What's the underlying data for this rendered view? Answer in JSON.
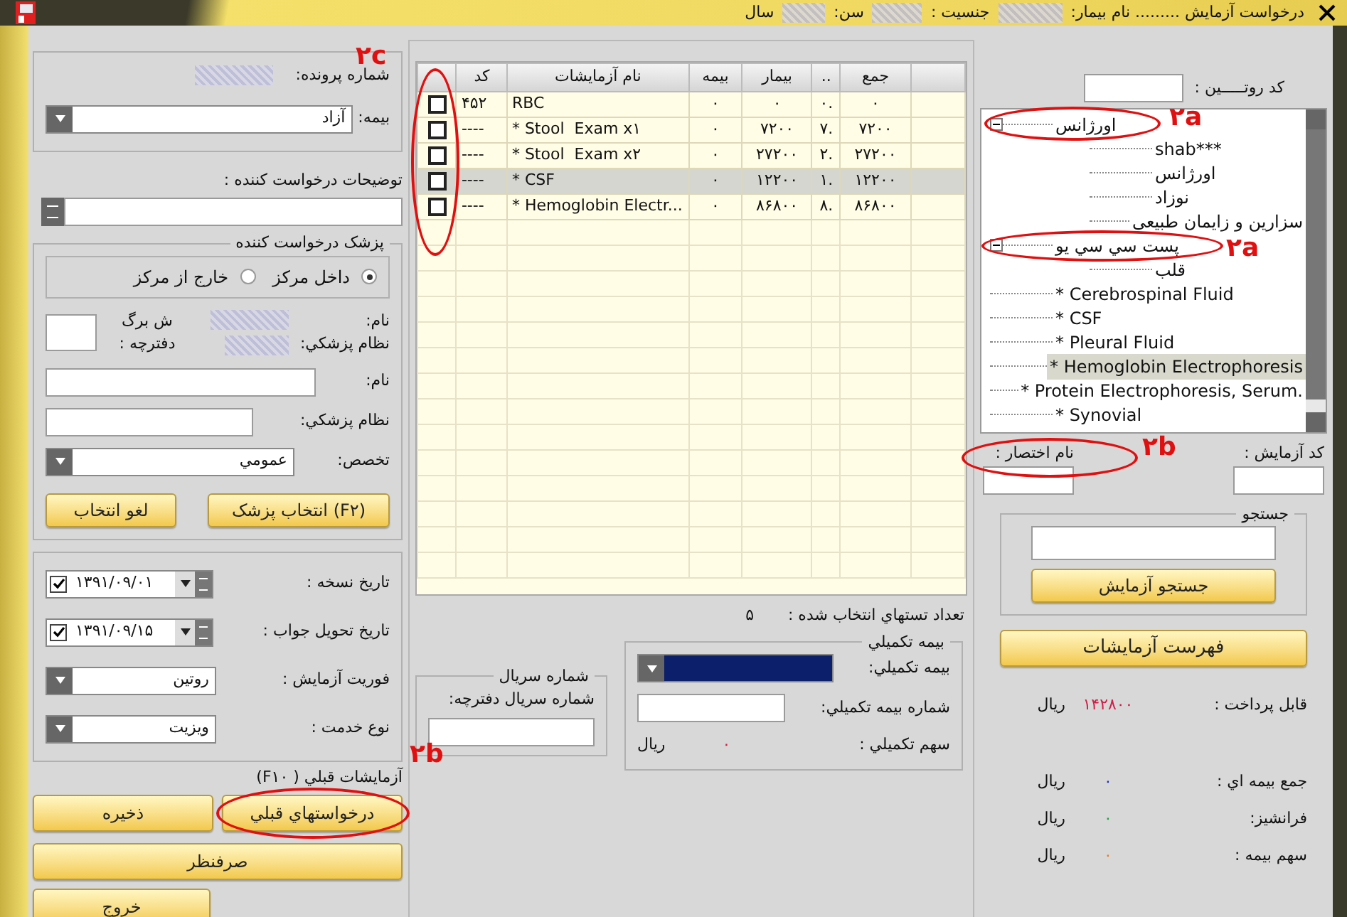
{
  "window": {
    "title": "درخواست آزمایش ......... نام بیمار:",
    "gender_label": "جنسیت :",
    "age_label": "سن:",
    "age_unit": "سال"
  },
  "left_panel": {
    "file_label": "شماره پرونده:",
    "insurance_label": "بیمه:",
    "insurance_value": "آزاد",
    "requester_notes_label": "توضیحات درخواست کننده :",
    "physician": {
      "legend": "پزشک درخواست کننده",
      "options": [
        {
          "label": "داخل مرکز",
          "selected": true
        },
        {
          "label": "خارج از مرکز",
          "selected": false
        }
      ],
      "name_label": "نام:",
      "code_label": "نظام پزشکي:",
      "sheet_label": "ش برگ دفترچه :",
      "name_field_label": "نام:",
      "code_field_label": "نظام پزشکي:",
      "specialty_label": "تخصص:",
      "specialty_value": "عمومي",
      "select_button": "(F۲) انتخاب پزشک",
      "cancel_button": "لغو انتخاب"
    },
    "dates": [
      {
        "label": "تاریخ نسخه :",
        "value": "۱۳۹۱/۰۹/۰۱",
        "checked": true
      },
      {
        "label": "تاریخ تحویل جواب :",
        "value": "۱۳۹۱/۰۹/۱۵",
        "checked": true
      }
    ],
    "combos": [
      {
        "label": "فوریت آزمایش :",
        "value": "روتین"
      },
      {
        "label": "نوع خدمت :",
        "value": "ویزیت"
      }
    ],
    "previous_label": "آزمایشات قبلي ( F۱۰)",
    "previous_button": "درخواستهاي قبلي",
    "save_button": "ذخیره",
    "cancel_button": "صرفنظر",
    "exit_button": "خروج"
  },
  "grid": {
    "columns": [
      "جمع",
      "..",
      "بیمار",
      "بیمه",
      "نام آزمایشات",
      "کد"
    ],
    "rows": [
      {
        "checked": false,
        "selected": false,
        "cells": [
          "۰",
          "۰.",
          "۰",
          "۰",
          "RBC",
          "۴۵۲"
        ]
      },
      {
        "checked": false,
        "selected": false,
        "cells": [
          "۷۲۰۰",
          "۷.",
          "۷۲۰۰",
          "۰",
          "* Stool  Exam x۱",
          "----"
        ]
      },
      {
        "checked": false,
        "selected": false,
        "cells": [
          "۲۷۲۰۰",
          "۲.",
          "۲۷۲۰۰",
          "۰",
          "* Stool  Exam x۲",
          "----"
        ]
      },
      {
        "checked": false,
        "selected": true,
        "cells": [
          "۱۲۲۰۰",
          "۱.",
          "۱۲۲۰۰",
          "۰",
          "* CSF",
          "----"
        ]
      },
      {
        "checked": false,
        "selected": false,
        "cells": [
          "۸۶۸۰۰",
          "۸.",
          "۸۶۸۰۰",
          "۰",
          "* Hemoglobin Electr...",
          "----"
        ]
      }
    ]
  },
  "selected_count_label": "تعداد تستهاي انتخاب شده :",
  "selected_count": "۵",
  "supplementary": {
    "legend": "بیمه تکمیلي",
    "insurance_label": "بیمه تکمیلي:",
    "number_label": "شماره بیمه تکمیلي:",
    "share_label": "سهم تکمیلي :",
    "share_value": "۰",
    "share_unit": "ريال"
  },
  "serial": {
    "legend": "شماره سريال",
    "label": "شماره سريال دفترچه:"
  },
  "right_panel": {
    "routine_label": "کد روتـــــین :",
    "tree": [
      {
        "label": "اورژانس",
        "expanded": true,
        "selected": false,
        "children": [
          {
            "label": "shab***",
            "selected": false
          },
          {
            "label": "اورژانس",
            "selected": false
          },
          {
            "label": "نوزاد",
            "selected": false
          },
          {
            "label": "سزارین و زایمان طبیعی",
            "selected": false
          }
        ]
      },
      {
        "label": "پست سي سي يو",
        "expanded": true,
        "selected": false,
        "children": [
          {
            "label": "قلب",
            "selected": false
          }
        ]
      },
      {
        "label": "* Cerebrospinal Fluid",
        "selected": false
      },
      {
        "label": "* CSF",
        "selected": false
      },
      {
        "label": "* Pleural Fluid",
        "selected": false
      },
      {
        "label": "* Hemoglobin Electrophoresis",
        "selected": true
      },
      {
        "label": "* Protein Electrophoresis, Serum.",
        "selected": false
      },
      {
        "label": "* Synovial",
        "selected": false
      }
    ],
    "test_code_label": "کد آزمایش :",
    "short_name_label": "نام اختصار :",
    "search_legend": "جستجو",
    "search_button": "جستجو آزمایش",
    "list_button": "فهرست آزمایشات",
    "totals": [
      {
        "label": "قابل پرداخت :",
        "value": "۱۴۲۸۰۰",
        "unit": "ريال",
        "color": "#d0204a"
      },
      {
        "label": "جمع بیمه اي :",
        "value": "۰",
        "unit": "ريال",
        "color": "#2030c0"
      },
      {
        "label": "فرانشیز:",
        "value": "۰",
        "unit": "ريال",
        "color": "#20a040"
      },
      {
        "label": "سهم بیمه :",
        "value": "۰",
        "unit": "ريال",
        "color": "#e08030"
      }
    ]
  },
  "annotations": [
    {
      "text": "۲c"
    },
    {
      "text": "۲a"
    },
    {
      "text": "۲a"
    },
    {
      "text": "۲b"
    },
    {
      "text": "۲b"
    }
  ]
}
